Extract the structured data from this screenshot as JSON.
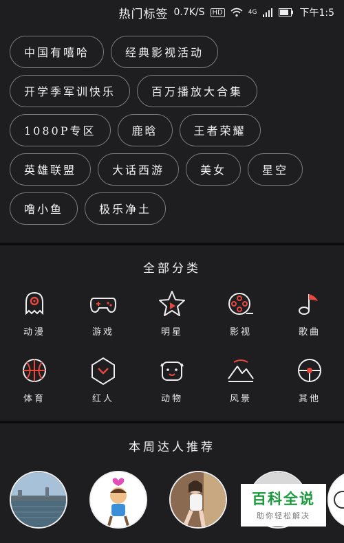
{
  "status_bar": {
    "title": "热门标签",
    "speed": "0.7K/S",
    "hd": "HD",
    "network": "4G",
    "time": "下午1:5"
  },
  "hot_tags": [
    "中国有嘻哈",
    "经典影视活动",
    "开学季军训快乐",
    "百万播放大合集",
    "1080P专区",
    "鹿晗",
    "王者荣耀",
    "英雄联盟",
    "大话西游",
    "美女",
    "星空",
    "噜小鱼",
    "极乐净土"
  ],
  "categories": {
    "title": "全部分类",
    "items": [
      {
        "label": "动漫",
        "icon": "ghost-icon"
      },
      {
        "label": "游戏",
        "icon": "gamepad-icon"
      },
      {
        "label": "明星",
        "icon": "star-icon"
      },
      {
        "label": "影视",
        "icon": "film-reel-icon"
      },
      {
        "label": "歌曲",
        "icon": "music-note-icon"
      },
      {
        "label": "体育",
        "icon": "basketball-icon"
      },
      {
        "label": "红人",
        "icon": "red-person-icon"
      },
      {
        "label": "动物",
        "icon": "animal-face-icon"
      },
      {
        "label": "风景",
        "icon": "mountain-icon"
      },
      {
        "label": "其他",
        "icon": "other-icon"
      }
    ]
  },
  "recommend": {
    "title": "本周达人推荐"
  },
  "watermark": {
    "title": "百科全说",
    "subtitle": "助你轻松解决"
  },
  "colors": {
    "accent": "#e8483e",
    "background": "#1e1e20",
    "line": "#e9e9e9"
  }
}
